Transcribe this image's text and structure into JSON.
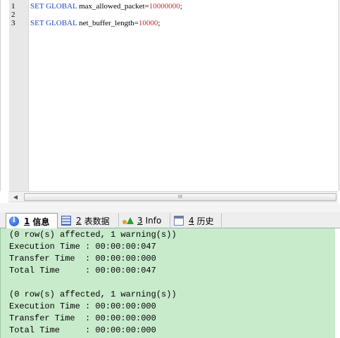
{
  "editor": {
    "line_numbers": [
      "1",
      "2",
      "3"
    ],
    "lines": [
      {
        "kw": "SET GLOBAL",
        "rest": " max_allowed_packet=",
        "num": "10000000",
        "end": ";"
      },
      {
        "kw": "",
        "rest": "",
        "num": "",
        "end": ""
      },
      {
        "kw": "SET GLOBAL",
        "rest": " net_buffer_length=",
        "num": "10000",
        "end": ";"
      }
    ],
    "colors": {
      "keyword": "#1c46c8",
      "number": "#cc2a2a",
      "gutter": "#e8e8e8"
    }
  },
  "scrollbar": {
    "left_arrow": "◀",
    "right_arrow": "▶",
    "grip": "III"
  },
  "tabs": [
    {
      "number": "1",
      "label": "信息",
      "icon": "info-icon",
      "active": true
    },
    {
      "number": "2",
      "label": "表数据",
      "icon": "table-grid-icon",
      "active": false
    },
    {
      "number": "3",
      "label": "Info",
      "icon": "shapes-icon",
      "active": false
    },
    {
      "number": "4",
      "label": "历史",
      "icon": "calendar-icon",
      "active": false
    }
  ],
  "output": {
    "background": "#c8ebcc",
    "lines": [
      "(0 row(s) affected, 1 warning(s))",
      "Execution Time : 00:00:00:047",
      "Transfer Time  : 00:00:00:000",
      "Total Time     : 00:00:00:047",
      "",
      "(0 row(s) affected, 1 warning(s))",
      "Execution Time : 00:00:00:000",
      "Transfer Time  : 00:00:00:000",
      "Total Time     : 00:00:00:000"
    ]
  }
}
